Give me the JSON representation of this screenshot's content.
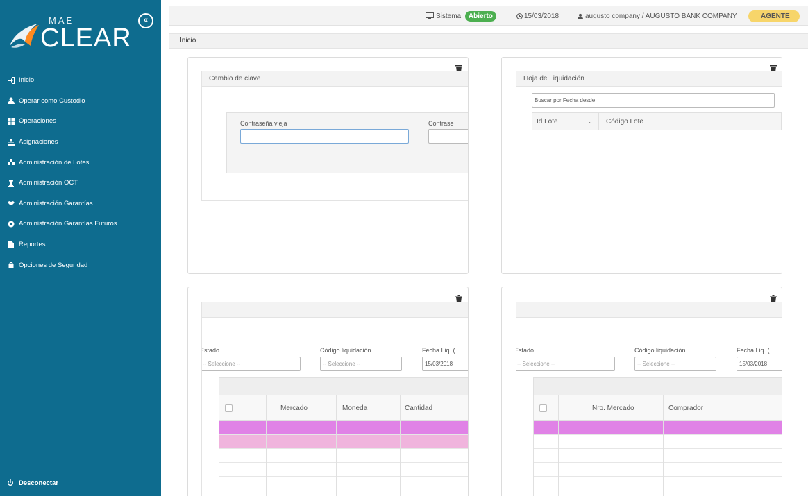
{
  "app": {
    "brand_small": "MAE",
    "brand_large": "CLEAR"
  },
  "sidebar": {
    "items": [
      {
        "label": "Inicio",
        "icon": "sign-in-icon"
      },
      {
        "label": "Operar como Custodio",
        "icon": "user-icon"
      },
      {
        "label": "Operaciones",
        "icon": "th-large-icon"
      },
      {
        "label": "Asignaciones",
        "icon": "sitemap-icon"
      },
      {
        "label": "Administración de Lotes",
        "icon": "cubes-icon"
      },
      {
        "label": "Administración OCT",
        "icon": "hourglass-icon"
      },
      {
        "label": "Administración Garantías",
        "icon": "handshake-icon"
      },
      {
        "label": "Administración Garantías Futuros",
        "icon": "recycle-icon"
      },
      {
        "label": "Reportes",
        "icon": "file-icon"
      },
      {
        "label": "Opciones de Seguridad",
        "icon": "lock-icon"
      }
    ],
    "logout": "Desconectar",
    "colors": {
      "background": "#0e6c8f"
    }
  },
  "topbar": {
    "system_label": "Sistema:",
    "system_status": "Abierto",
    "date": "15/03/2018",
    "user": "augusto company / AUGUSTO BANK COMPANY",
    "role": "AGENTE",
    "colors": {
      "open": "#4caf50",
      "role": "#f7d56a"
    }
  },
  "breadcrumb": "Inicio",
  "widgets": {
    "password": {
      "title": "Cambio de clave",
      "old_label": "Contraseña vieja",
      "new_label": "Contrase"
    },
    "liquidacion": {
      "title": "Hoja de Liquidación",
      "search_placeholder": "Buscar por Fecha desde",
      "columns": [
        "Id Lote",
        "Código Lote"
      ]
    },
    "grid_left": {
      "labels": [
        "Estado",
        "Código liquidación",
        "Fecha Liq. ("
      ],
      "select_placeholder": "-- Seleccione --",
      "date_value": "15/03/2018",
      "columns": [
        "",
        "",
        "Mercado",
        "Moneda",
        "Cantidad"
      ],
      "row_colors": [
        "#e082e6",
        "#f0b4dd"
      ]
    },
    "grid_right": {
      "labels": [
        "Estado",
        "Código liquidación",
        "Fecha Liq. ("
      ],
      "select_placeholder": "-- Seleccione --",
      "date_value": "15/03/2018",
      "columns": [
        "",
        "",
        "Nro. Mercado",
        "Comprador"
      ],
      "row_colors": [
        "#e082e6"
      ]
    }
  }
}
